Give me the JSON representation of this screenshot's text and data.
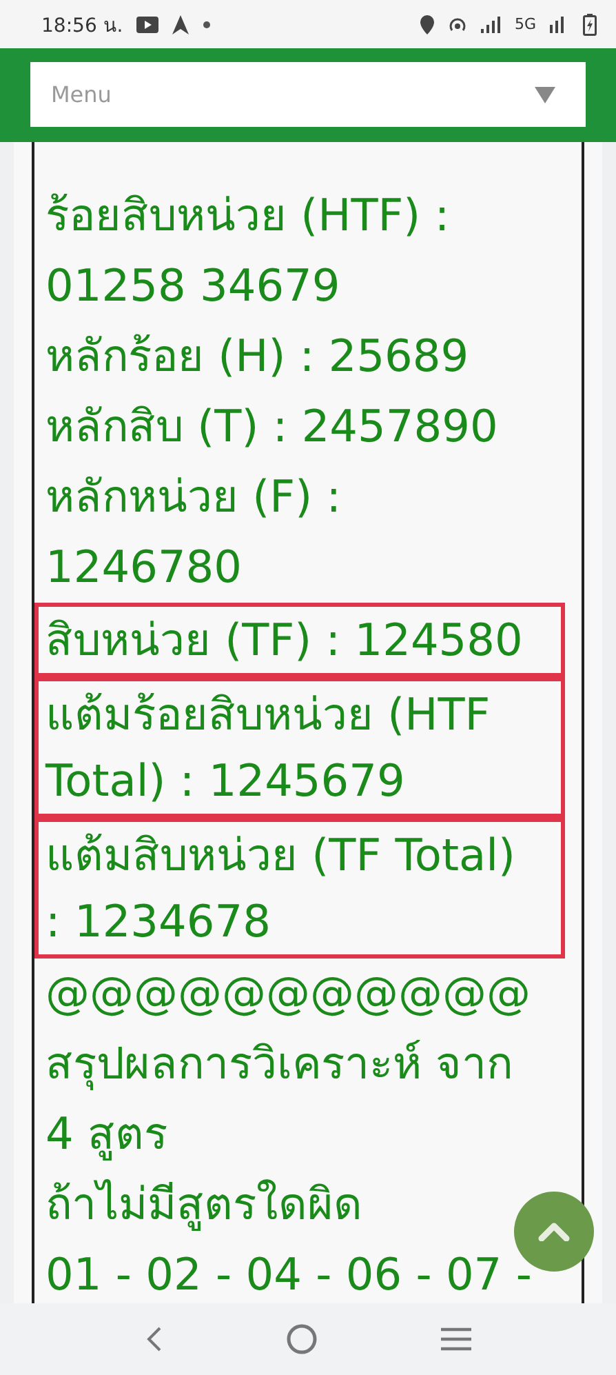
{
  "status_bar": {
    "time": "18:56 น.",
    "network": "5G"
  },
  "menu": {
    "placeholder": "Menu"
  },
  "entries": [
    {
      "lines": [
        "ร้อยสิบหน่วย (HTF) :",
        "01258 34679"
      ],
      "highlighted": false
    },
    {
      "lines": [
        "หลักร้อย (H) : 25689"
      ],
      "highlighted": false
    },
    {
      "lines": [
        "หลักสิบ (T) : 2457890"
      ],
      "highlighted": false
    },
    {
      "lines": [
        "หลักหน่วย (F) :",
        "1246780"
      ],
      "highlighted": false
    },
    {
      "lines": [
        "สิบหน่วย (TF) : 124580"
      ],
      "highlighted": true
    },
    {
      "lines": [
        "แต้มร้อยสิบหน่วย (HTF",
        "Total) : 1245679"
      ],
      "highlighted": true
    },
    {
      "lines": [
        "แต้มสิบหน่วย (TF Total)",
        ": 1234678"
      ],
      "highlighted": true
    },
    {
      "lines": [
        "@@@@@@@@@@@"
      ],
      "highlighted": false
    },
    {
      "lines": [
        "สรุปผลการวิเคราะห์ จาก",
        "4 สูตร"
      ],
      "highlighted": false
    },
    {
      "lines": [
        "ถ้าไม่มีสูตรใดผิด"
      ],
      "highlighted": false
    },
    {
      "lines": [
        "01 - 02 - 04 - 06 - 07 -"
      ],
      "highlighted": false
    }
  ]
}
